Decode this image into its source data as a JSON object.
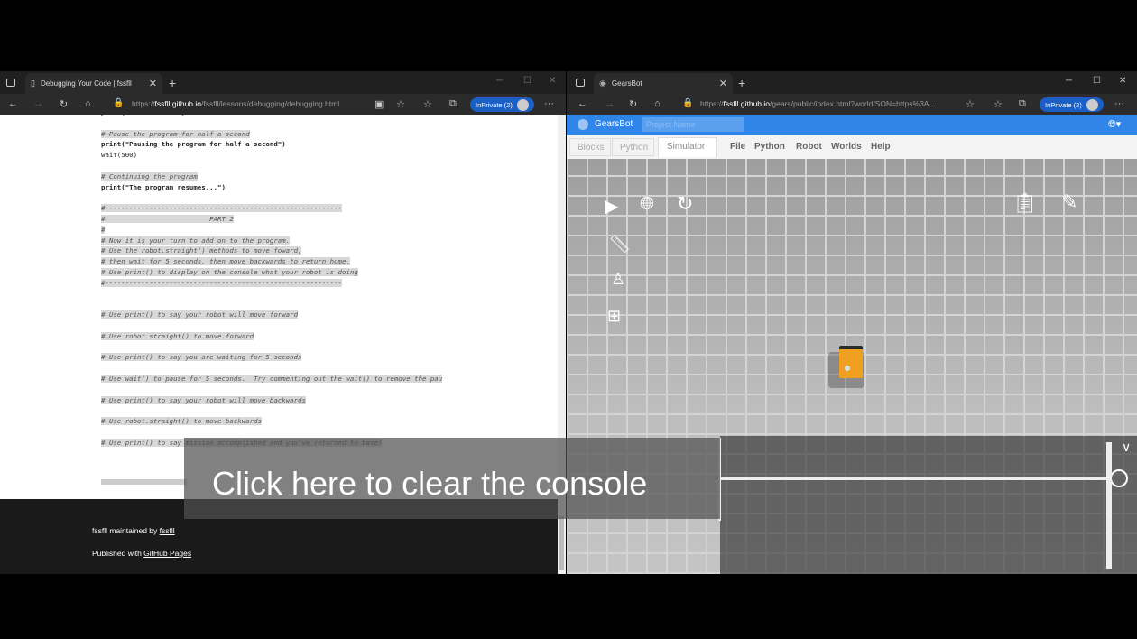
{
  "left_browser": {
    "tab_title": "Debugging Your Code | fssfll",
    "url_prefix": "https://",
    "url_host": "fssfll.github.io",
    "url_path": "/fssfll/lessons/debugging/debugging.html",
    "inprivate": "InPrivate (2)"
  },
  "code_lines": [
    {
      "text": "print(\"Hello World!\")",
      "cls": "k"
    },
    {
      "text": "",
      "cls": ""
    },
    {
      "text": "# Pause the program for half a second",
      "cls": "c"
    },
    {
      "text": "print(\"Pausing the program for half a second\")",
      "cls": "k"
    },
    {
      "text": "wait(500)",
      "cls": ""
    },
    {
      "text": "",
      "cls": ""
    },
    {
      "text": "# Continuing the program",
      "cls": "c"
    },
    {
      "text": "print(\"The program resumes...\")",
      "cls": "k"
    },
    {
      "text": "",
      "cls": ""
    },
    {
      "text": "#-----------------------------------------------------------",
      "cls": "c"
    },
    {
      "text": "#                          PART 2",
      "cls": "c"
    },
    {
      "text": "#",
      "cls": "c"
    },
    {
      "text": "# Now it is your turn to add on to the program.",
      "cls": "c"
    },
    {
      "text": "# Use the robot.straight() methods to move foward,",
      "cls": "c"
    },
    {
      "text": "# then wait for 5 seconds, then move backwards to return home.",
      "cls": "c"
    },
    {
      "text": "# Use print() to display on the console what your robot is doing",
      "cls": "c"
    },
    {
      "text": "#-----------------------------------------------------------",
      "cls": "c"
    },
    {
      "text": "",
      "cls": ""
    },
    {
      "text": "",
      "cls": ""
    },
    {
      "text": "# Use print() to say your robot will move forward",
      "cls": "c"
    },
    {
      "text": "",
      "cls": ""
    },
    {
      "text": "# Use robot.straight() to move forward",
      "cls": "c"
    },
    {
      "text": "",
      "cls": ""
    },
    {
      "text": "# Use print() to say you are waiting for 5 seconds",
      "cls": "c"
    },
    {
      "text": "",
      "cls": ""
    },
    {
      "text": "# Use wait() to pause for 5 seconds.  Try commenting out the wait() to remove the pau",
      "cls": "c"
    },
    {
      "text": "",
      "cls": ""
    },
    {
      "text": "# Use print() to say your robot will move backwards",
      "cls": "c"
    },
    {
      "text": "",
      "cls": ""
    },
    {
      "text": "# Use robot.straight() to move backwards",
      "cls": "c"
    },
    {
      "text": "",
      "cls": ""
    },
    {
      "text": "# Use print() to say mission accomplished and you've returned to base!",
      "cls": "c"
    }
  ],
  "footer": {
    "maintained_prefix": "fssfll maintained by ",
    "maintained_link": "fssfll",
    "published_prefix": "Published with ",
    "published_link": "GitHub Pages"
  },
  "right_browser": {
    "tab_title": "GearsBot",
    "url_prefix": "https://",
    "url_host": "fssfll.github.io",
    "url_path": "/gears/public/index.html?world/SON=https%3A...",
    "inprivate": "InPrivate (2)"
  },
  "gearsbot": {
    "title": "GearsBot",
    "project_placeholder": "Project Name",
    "tabs": [
      "Blocks",
      "Python",
      "Simulator"
    ],
    "menus": [
      "File",
      "Python",
      "Robot",
      "Worlds",
      "Help"
    ]
  },
  "overlay_text": "Click here to clear the console",
  "colors": {
    "accent": "#2f86e8",
    "robot": "#f0a020"
  }
}
